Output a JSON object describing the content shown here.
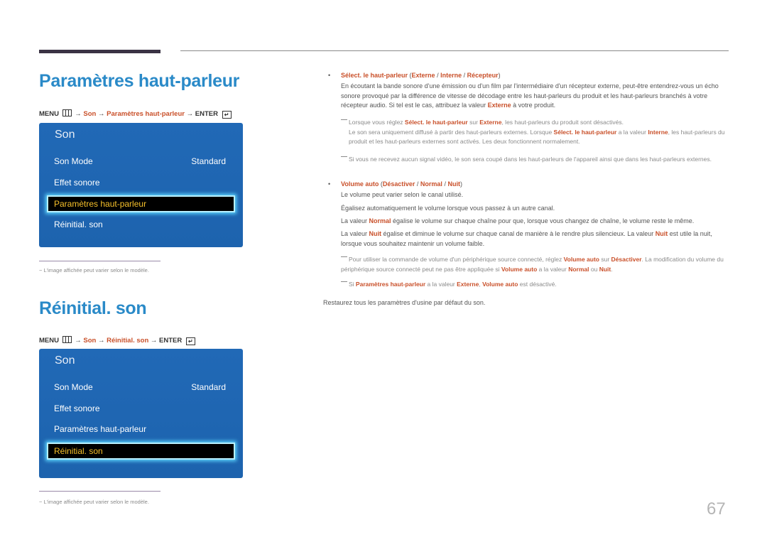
{
  "page_number": "67",
  "section1": {
    "title": "Paramètres haut-parleur",
    "menu_path": {
      "menu": "MENU",
      "arrow": "→",
      "son": "Son",
      "item": "Paramètres haut-parleur",
      "enter": "ENTER"
    },
    "osd": {
      "title": "Son",
      "items": [
        {
          "label": "Son Mode",
          "value": "Standard"
        },
        {
          "label": "Effet sonore"
        },
        {
          "label": "Paramètres haut-parleur",
          "selected": true
        },
        {
          "label": "Réinitial. son"
        }
      ]
    },
    "footnote": "L'image affichée peut varier selon le modèle."
  },
  "section2": {
    "title": "Réinitial. son",
    "menu_path": {
      "menu": "MENU",
      "arrow": "→",
      "son": "Son",
      "item": "Réinitial. son",
      "enter": "ENTER"
    },
    "osd": {
      "title": "Son",
      "items": [
        {
          "label": "Son Mode",
          "value": "Standard"
        },
        {
          "label": "Effet sonore"
        },
        {
          "label": "Paramètres haut-parleur"
        },
        {
          "label": "Réinitial. son",
          "selected": true
        }
      ]
    },
    "footnote": "L'image affichée peut varier selon le modèle."
  },
  "right": {
    "bullet_char": "•",
    "select_speaker": {
      "heading": "Sélect. le haut-parleur",
      "options": [
        "Externe",
        "Interne",
        "Récepteur"
      ],
      "body_1": "En écoutant la bande sonore d'une émission ou d'un film par l'intermédiaire d'un récepteur externe, peut-être entendrez-vous un écho sonore provoqué par la différence de vitesse de décodage entre les haut-parleurs du produit et les haut-parleurs branchés à votre récepteur audio. Si tel est le cas, attribuez la valeur ",
      "body_hl": "Externe",
      "body_2": " à votre produit.",
      "note1": {
        "t1": "Lorsque vous réglez ",
        "h1": "Sélect. le haut-parleur",
        "t2": " sur ",
        "h2": "Externe",
        "t3": ", les haut-parleurs du produit sont désactivés.",
        "t4": "Le son sera uniquement diffusé à partir des haut-parleurs externes. Lorsque ",
        "h3": "Sélect. le haut-parleur",
        "t5": " a la valeur ",
        "h4": "Interne",
        "t6": ", les haut-parleurs du produit et les haut-parleurs externes sont activés. Les deux fonctionnent normalement."
      },
      "note2": "Si vous ne recevez aucun signal vidéo, le son sera coupé dans les haut-parleurs de l'appareil ainsi que dans les haut-parleurs externes."
    },
    "volume_auto": {
      "heading": "Volume auto",
      "options": [
        "Désactiver",
        "Normal",
        "Nuit"
      ],
      "line1": "Le volume peut varier selon le canal utilisé.",
      "line2": "Égalisez automatiquement le volume lorsque vous passez à un autre canal.",
      "line3_a": "La valeur ",
      "line3_h": "Normal",
      "line3_b": " égalise le volume sur chaque chaîne pour que, lorsque vous changez de chaîne, le volume reste le même.",
      "line4_a": "La valeur ",
      "line4_h": "Nuit",
      "line4_b": " égalise et diminue le volume sur chaque canal de manière à le rendre plus silencieux. La valeur ",
      "line4_h2": "Nuit",
      "line4_c": " est utile la nuit, lorsque vous souhaitez maintenir un volume faible.",
      "note1": {
        "t1": "Pour utiliser la commande de volume d'un périphérique source connecté, réglez ",
        "h1": "Volume auto",
        "t2": " sur ",
        "h2": "Désactiver",
        "t3": ". La modification du volume du périphérique source connecté peut ne pas être appliquée si ",
        "h3": "Volume auto",
        "t4": " a la valeur ",
        "h4": "Normal",
        "t5": " ou ",
        "h5": "Nuit",
        "t6": "."
      },
      "note2": {
        "t1": "Si ",
        "h1": "Paramètres haut-parleur",
        "t2": " a la valeur ",
        "h2": "Externe",
        "t3": ", ",
        "h3": "Volume auto",
        "t4": " est désactivé."
      }
    },
    "restore_text": "Restaurez tous les paramètres d'usine par défaut du son."
  }
}
